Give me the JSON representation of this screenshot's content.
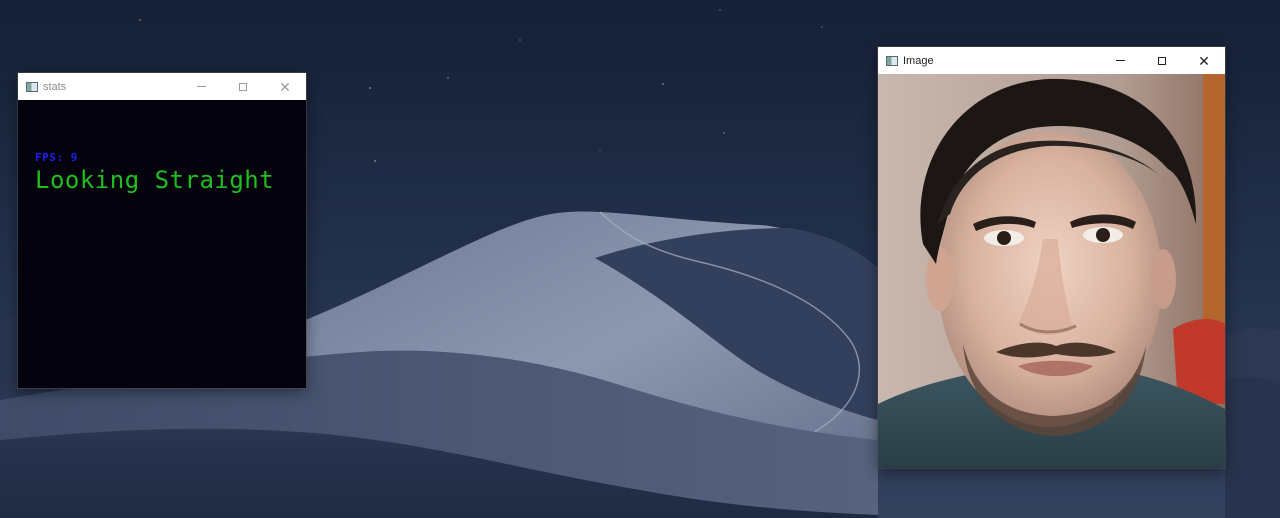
{
  "desktop": {
    "wallpaper": "desert-dunes-night"
  },
  "stats_window": {
    "title": "stats",
    "icon": "opencv-window-icon",
    "fps_text": "FPS: 9",
    "fps_color": "#1f1ff5",
    "gaze_text": "Looking Straight",
    "gaze_color": "#1fbf1f",
    "canvas_color": "#04020d"
  },
  "image_window": {
    "title": "Image",
    "icon": "opencv-window-icon",
    "content": "webcam-face-frame"
  },
  "caption_buttons": {
    "minimize": "minimize-icon",
    "maximize": "maximize-icon",
    "close": "close-icon",
    "close_glyph": "✕"
  }
}
